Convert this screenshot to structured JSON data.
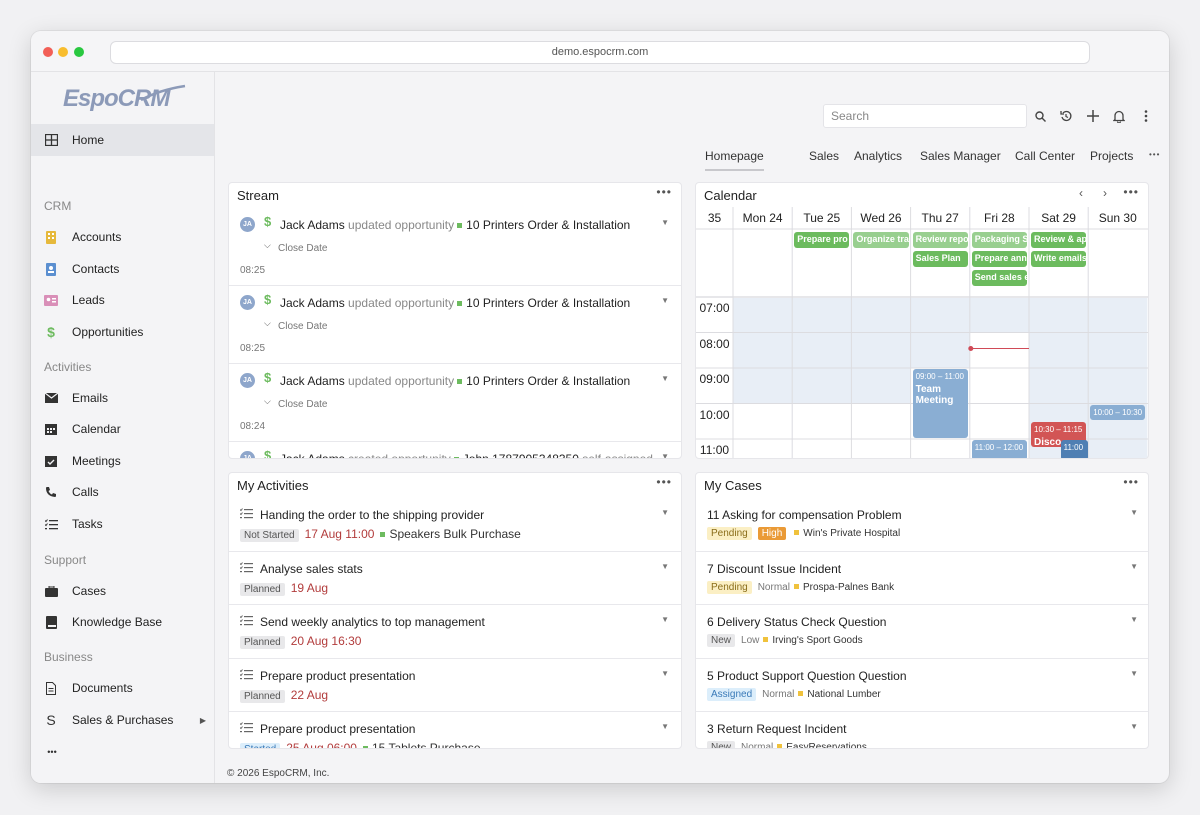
{
  "browser": {
    "url": "demo.espocrm.com"
  },
  "logo": "EspoCRM",
  "sidebar": {
    "home": "Home",
    "crm_section": "CRM",
    "crm": [
      "Accounts",
      "Contacts",
      "Leads",
      "Opportunities"
    ],
    "activities_section": "Activities",
    "activities": [
      "Emails",
      "Calendar",
      "Meetings",
      "Calls",
      "Tasks"
    ],
    "support_section": "Support",
    "support": [
      "Cases",
      "Knowledge Base"
    ],
    "business_section": "Business",
    "business": [
      "Documents",
      "Sales & Purchases"
    ],
    "more": "•••",
    "collapse": "‹"
  },
  "search": {
    "placeholder": "Search"
  },
  "tabs": [
    "Homepage",
    "Sales",
    "Analytics",
    "Sales Manager",
    "Call Center",
    "Projects"
  ],
  "more": "•••",
  "stream": {
    "title": "Stream",
    "items": [
      {
        "initials": "JA",
        "user": "Jack Adams",
        "action": "updated opportunity",
        "target": "10 Printers Order & Installation",
        "field": "Close Date",
        "time": "08:25"
      },
      {
        "initials": "JA",
        "user": "Jack Adams",
        "action": "updated opportunity",
        "target": "10 Printers Order & Installation",
        "field": "Close Date",
        "time": "08:25"
      },
      {
        "initials": "JA",
        "user": "Jack Adams",
        "action": "updated opportunity",
        "target": "10 Printers Order & Installation",
        "field": "Close Date",
        "time": "08:24"
      },
      {
        "initials": "JA",
        "user": "Jack Adams",
        "action": "created opportunity",
        "target": "John 1787905348350",
        "suffix": "self-assigned"
      }
    ]
  },
  "calendar": {
    "title": "Calendar",
    "week": "35",
    "days": [
      "Mon 24",
      "Tue 25",
      "Wed 26",
      "Thu 27",
      "Fri 28",
      "Sat 29",
      "Sun 30"
    ],
    "hours": [
      "07:00",
      "08:00",
      "09:00",
      "10:00",
      "11:00"
    ],
    "allday_events": [
      {
        "day": 1,
        "row": 0,
        "label": "Prepare pro",
        "color": "green"
      },
      {
        "day": 2,
        "row": 0,
        "label": "Organize tra",
        "color": "lgreen"
      },
      {
        "day": 3,
        "row": 0,
        "label": "Review repo",
        "color": "lgreen"
      },
      {
        "day": 3,
        "row": 1,
        "label": "Sales Plan",
        "color": "green"
      },
      {
        "day": 4,
        "row": 0,
        "label": "Packaging S",
        "color": "lgreen"
      },
      {
        "day": 4,
        "row": 1,
        "label": "Prepare ann",
        "color": "green"
      },
      {
        "day": 4,
        "row": 2,
        "label": "Send sales e",
        "color": "green"
      },
      {
        "day": 5,
        "row": 0,
        "label": "Review & ap",
        "color": "green"
      },
      {
        "day": 5,
        "row": 1,
        "label": "Write emails",
        "color": "green"
      }
    ],
    "timed_events": [
      {
        "day": 3,
        "start": 9.0,
        "end": 11.0,
        "time": "09:00 – 11:00",
        "label": "Team Meeting",
        "color": "blue"
      },
      {
        "day": 6,
        "start": 10.0,
        "end": 10.5,
        "time": "10:00 – 10:30",
        "label": "",
        "color": "blue"
      },
      {
        "day": 5,
        "start": 10.5,
        "end": 11.25,
        "time": "10:30 – 11:15",
        "label": "Disco",
        "color": "red"
      },
      {
        "day": 4,
        "start": 11.0,
        "end": 12.0,
        "time": "11:00 – 12:00",
        "label": "",
        "color": "blue"
      },
      {
        "day": 5.5,
        "start": 11.0,
        "end": 12.0,
        "time": "11:00 –",
        "label": "",
        "color": "dblue"
      }
    ]
  },
  "activities": {
    "title": "My Activities",
    "items": [
      {
        "name": "Handing the order to the shipping provider",
        "status": "Not Started",
        "date": "17 Aug 11:00",
        "parent": "Speakers Bulk Purchase"
      },
      {
        "name": "Analyse sales stats",
        "status": "Planned",
        "date": "19 Aug",
        "parent": ""
      },
      {
        "name": "Send weekly analytics to top management",
        "status": "Planned",
        "date": "20 Aug 16:30",
        "parent": ""
      },
      {
        "name": "Prepare product presentation",
        "status": "Planned",
        "date": "22 Aug",
        "parent": ""
      },
      {
        "name": "Prepare product presentation",
        "status": "Started",
        "date": "25 Aug 06:00",
        "parent": "15 Tablets Purchase"
      }
    ]
  },
  "cases": {
    "title": "My Cases",
    "items": [
      {
        "num": "11",
        "name": "Asking for compensation",
        "type": "Problem",
        "status": "Pending",
        "priority": "High",
        "account": "Win's Private Hospital"
      },
      {
        "num": "7",
        "name": "Discount Issue",
        "type": "Incident",
        "status": "Pending",
        "priority": "Normal",
        "account": "Prospa-Palnes Bank"
      },
      {
        "num": "6",
        "name": "Delivery Status Check",
        "type": "Question",
        "status": "New",
        "priority": "Low",
        "account": "Irving's Sport Goods"
      },
      {
        "num": "5",
        "name": "Product Support Question",
        "type": "Question",
        "status": "Assigned",
        "priority": "Normal",
        "account": "National Lumber"
      },
      {
        "num": "3",
        "name": "Return Request",
        "type": "Incident",
        "status": "New",
        "priority": "Normal",
        "account": "EasyReservations"
      }
    ]
  },
  "footer": "© 2026 EspoCRM, Inc."
}
